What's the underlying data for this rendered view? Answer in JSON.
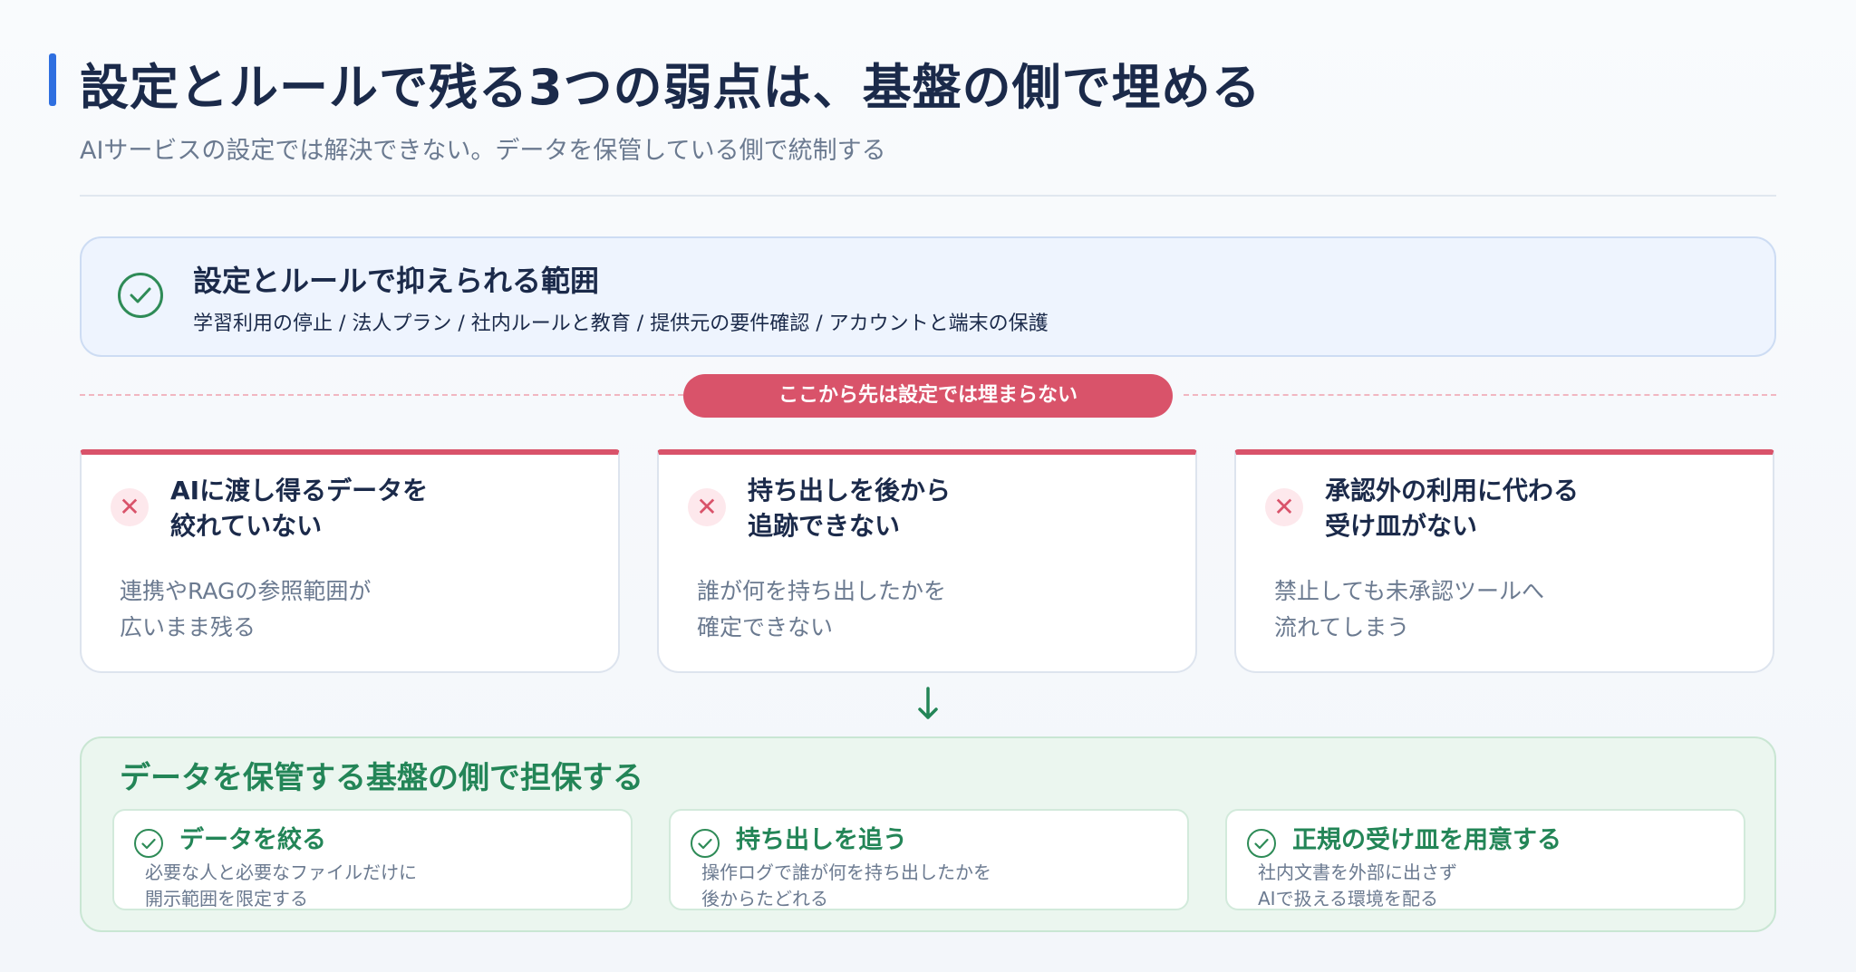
{
  "header": {
    "title": "設定とルールで残る3つの弱点は、基盤の側で埋める",
    "subtitle": "AIサービスの設定では解決できない。データを保管している側で統制する"
  },
  "scope": {
    "title": "設定とルールで抑えられる範囲",
    "items": "学習利用の停止 / 法人プラン / 社内ルールと教育 / 提供元の要件確認 / アカウントと端末の保護",
    "icon": "check-circle-icon"
  },
  "divider": {
    "label": "ここから先は設定では埋まらない"
  },
  "weaknesses": [
    {
      "title": "AIに渡し得るデータを\n絞れていない",
      "desc": "連携やRAGの参照範囲が\n広いまま残る",
      "icon": "x-icon"
    },
    {
      "title": "持ち出しを後から\n追跡できない",
      "desc": "誰が何を持ち出したかを\n確定できない",
      "icon": "x-icon"
    },
    {
      "title": "承認外の利用に代わる\n受け皿がない",
      "desc": "禁止しても未承認ツールへ\n流れてしまう",
      "icon": "x-icon"
    }
  ],
  "solution": {
    "title": "データを保管する基盤の側で担保する",
    "items": [
      {
        "title": "データを絞る",
        "desc": "必要な人と必要なファイルだけに\n開示範囲を限定する"
      },
      {
        "title": "持ち出しを追う",
        "desc": "操作ログで誰が何を持ち出したかを\n後からたどれる"
      },
      {
        "title": "正規の受け皿を用意する",
        "desc": "社内文書を外部に出さず\nAIで扱える環境を配る"
      }
    ]
  },
  "colors": {
    "accent": "#2f6fe0",
    "danger": "#d9536a",
    "success": "#238557",
    "text": "#1b2a4a",
    "muted": "#6b7a90"
  }
}
